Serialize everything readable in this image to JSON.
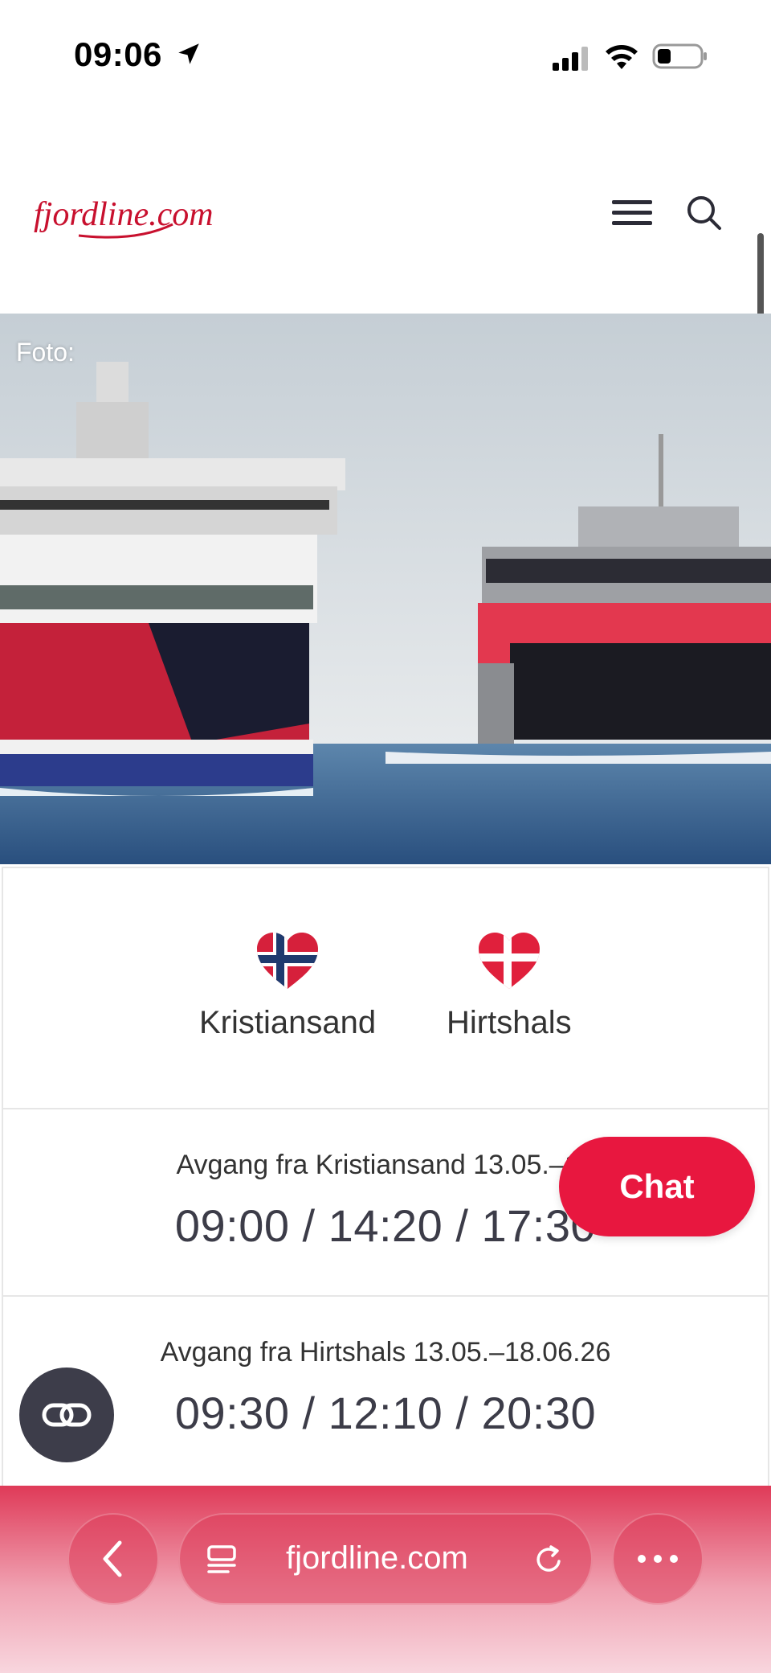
{
  "status_bar": {
    "time": "09:06",
    "icons": [
      "location-arrow-icon",
      "cellular-signal-icon",
      "wifi-icon",
      "battery-icon"
    ]
  },
  "header": {
    "logo_text": "fjordline.com",
    "brand_color": "#c8102e",
    "icons": [
      "hamburger-menu-icon",
      "search-icon"
    ]
  },
  "hero": {
    "caption": "Foto:"
  },
  "route": {
    "from": "Kristiansand",
    "to": "Hirtshals",
    "from_flag": "norway-heart-flag",
    "to_flag": "denmark-heart-flag"
  },
  "departures": [
    {
      "title": "Avgang fra Kristiansand 13.05.–18",
      "times": "09:00 / 14:20 / 17:30"
    },
    {
      "title": "Avgang fra Hirtshals 13.05.–18.06.26",
      "times": "09:30 / 12:10 / 20:30"
    }
  ],
  "chat": {
    "label": "Chat",
    "color": "#e8173f"
  },
  "browser_bar": {
    "url": "fjordline.com",
    "icons": [
      "back-chevron-icon",
      "tabs-icon",
      "reload-icon",
      "more-icon"
    ]
  }
}
